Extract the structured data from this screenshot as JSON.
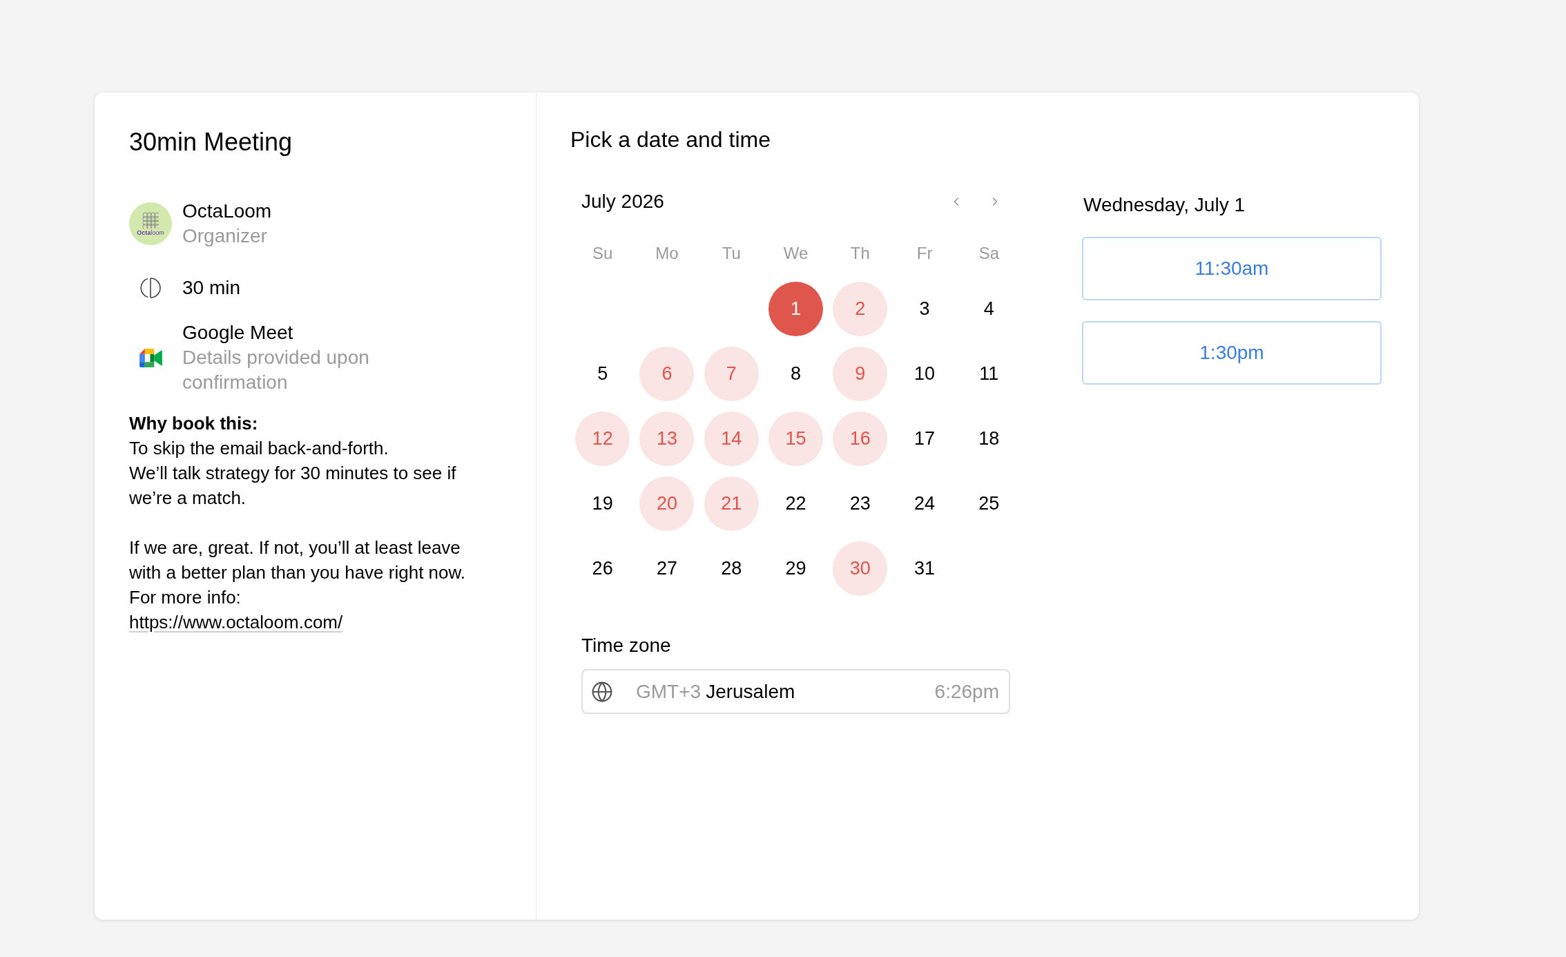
{
  "event": {
    "title": "30min Meeting",
    "organizer": {
      "logo_text": "**Octa**loom",
      "name": "OctaLoom",
      "role": "Organizer"
    },
    "duration": "30 min",
    "location": {
      "name": "Google Meet",
      "detail": "Details provided upon confirmation"
    },
    "description": {
      "heading": "Why book this:",
      "paragraphs": [
        "To skip the email back-and-forth.\nWe’ll talk strategy for 30 minutes to see if we’re a match.",
        "If we are, great. If not, you’ll at least leave with a better plan than you have right now.\nFor more info:"
      ],
      "link": "https://www.octaloom.com/"
    }
  },
  "scheduler": {
    "title": "Pick a date and time",
    "calendar": {
      "month": "July 2026",
      "weekdays": [
        "Su",
        "Mo",
        "Tu",
        "We",
        "Th",
        "Fr",
        "Sa"
      ],
      "weeks": [
        [
          {
            "day": "1",
            "available": true,
            "selected": true
          },
          {
            "day": "2",
            "available": true,
            "selected": false
          },
          {
            "day": "3",
            "available": false,
            "selected": false
          },
          {
            "day": "4",
            "available": false,
            "selected": false
          }
        ],
        [
          {
            "day": "5",
            "available": false,
            "selected": false
          },
          {
            "day": "6",
            "available": true,
            "selected": false
          },
          {
            "day": "7",
            "available": true,
            "selected": false
          },
          {
            "day": "8",
            "available": false,
            "selected": false
          },
          {
            "day": "9",
            "available": true,
            "selected": false
          },
          {
            "day": "10",
            "available": false,
            "selected": false
          },
          {
            "day": "11",
            "available": false,
            "selected": false
          }
        ],
        [
          {
            "day": "12",
            "available": true,
            "selected": false
          },
          {
            "day": "13",
            "available": true,
            "selected": false
          },
          {
            "day": "14",
            "available": true,
            "selected": false
          },
          {
            "day": "15",
            "available": true,
            "selected": false
          },
          {
            "day": "16",
            "available": true,
            "selected": false
          },
          {
            "day": "17",
            "available": false,
            "selected": false
          },
          {
            "day": "18",
            "available": false,
            "selected": false
          }
        ],
        [
          {
            "day": "19",
            "available": false,
            "selected": false
          },
          {
            "day": "20",
            "available": true,
            "selected": false
          },
          {
            "day": "21",
            "available": true,
            "selected": false
          },
          {
            "day": "22",
            "available": false,
            "selected": false
          },
          {
            "day": "23",
            "available": false,
            "selected": false
          },
          {
            "day": "24",
            "available": false,
            "selected": false
          },
          {
            "day": "25",
            "available": false,
            "selected": false
          }
        ],
        [
          {
            "day": "26",
            "available": false,
            "selected": false
          },
          {
            "day": "27",
            "available": false,
            "selected": false
          },
          {
            "day": "28",
            "available": false,
            "selected": false
          },
          {
            "day": "29",
            "available": false,
            "selected": false
          },
          {
            "day": "30",
            "available": true,
            "selected": false
          },
          {
            "day": "31",
            "available": false,
            "selected": false
          }
        ]
      ]
    },
    "time_zone": {
      "label": "Time zone",
      "offset": "GMT+3",
      "city": "Jerusalem",
      "local_time": "6:26pm"
    },
    "day_panel": {
      "date": "Wednesday, July 1",
      "slots": [
        {
          "time": "11:30am",
          "selected": false
        },
        {
          "time": "1:30pm",
          "selected": false
        }
      ]
    }
  }
}
